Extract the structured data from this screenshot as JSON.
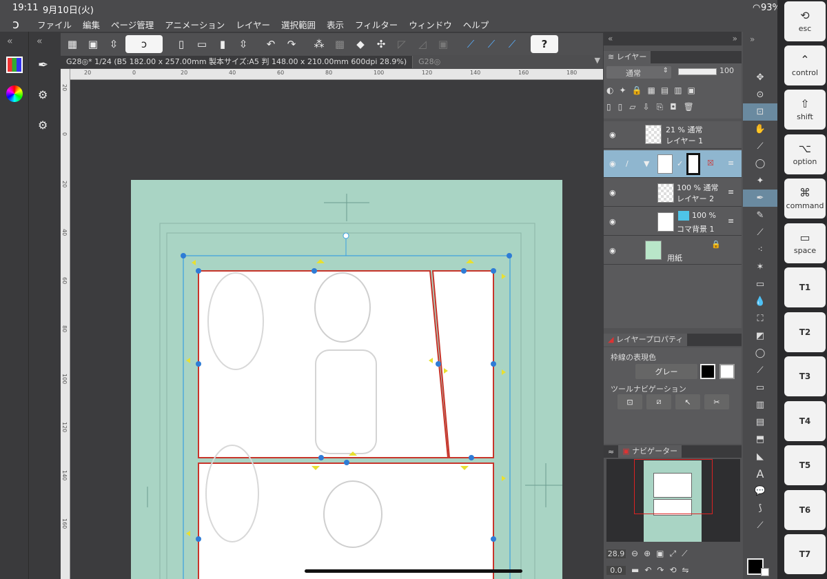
{
  "status": {
    "time": "19:11",
    "date": "9月10日(火)",
    "battery": "93%"
  },
  "menu": [
    "ファイル",
    "編集",
    "ページ管理",
    "アニメーション",
    "レイヤー",
    "選択範囲",
    "表示",
    "フィルター",
    "ウィンドウ",
    "ヘルプ"
  ],
  "doc_tabs": [
    {
      "label": "G28◎* 1/24 (B5 182.00 x 257.00mm 製本サイズ:A5 判 148.00 x 210.00mm 600dpi 28.9%)"
    },
    {
      "label": "G28◎"
    }
  ],
  "ruler_top_ticks": [
    "20",
    "0",
    "20",
    "40",
    "60",
    "80",
    "100",
    "120",
    "140",
    "160",
    "180"
  ],
  "ruler_left_ticks": [
    "20",
    "0",
    "20",
    "40",
    "60",
    "80",
    "100",
    "120",
    "140",
    "160"
  ],
  "layer_panel": {
    "title": "レイヤー",
    "blend_mode": "通常",
    "opacity": "100",
    "layers": [
      {
        "name": "レイヤー 1",
        "info": "21 % 通常"
      },
      {
        "name": "",
        "info": ""
      },
      {
        "name": "レイヤー 2",
        "info": "100 % 通常"
      },
      {
        "name": "コマ背景 1",
        "info": "100 %"
      },
      {
        "name": "用紙",
        "info": ""
      }
    ]
  },
  "property_panel": {
    "title": "レイヤープロパティ",
    "border_label": "枠線の表現色",
    "color_value": "グレー",
    "nav_label": "ツールナビゲーション"
  },
  "navigator": {
    "title": "ナビゲーター",
    "zoom": "28.9",
    "rotation": "0.0"
  },
  "shortcuts": [
    {
      "label": "esc",
      "icon": "⟲"
    },
    {
      "label": "control",
      "icon": "⌃"
    },
    {
      "label": "shift",
      "icon": "⇧"
    },
    {
      "label": "option",
      "icon": "⌥"
    },
    {
      "label": "command",
      "icon": "⌘"
    },
    {
      "label": "space",
      "icon": "▭"
    },
    {
      "label": "T1",
      "icon": ""
    },
    {
      "label": "T2",
      "icon": ""
    },
    {
      "label": "T3",
      "icon": ""
    },
    {
      "label": "T4",
      "icon": ""
    },
    {
      "label": "T5",
      "icon": ""
    },
    {
      "label": "T6",
      "icon": ""
    },
    {
      "label": "T7",
      "icon": ""
    }
  ],
  "colors": {
    "page": "#a9d4c4",
    "panel_border": "#c8342a",
    "selection": "#3aa0e0",
    "handle": "#2e7cd6",
    "accent": "#8fb6cf"
  }
}
